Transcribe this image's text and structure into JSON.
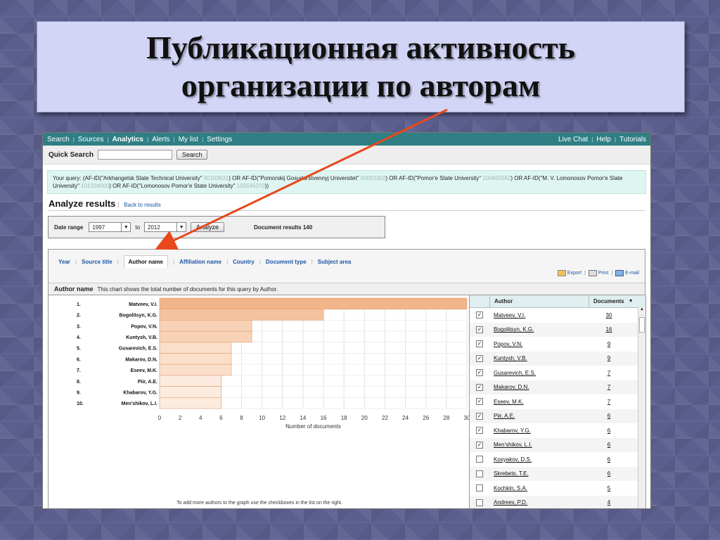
{
  "slide": {
    "title_line1": "Публикационная активность",
    "title_line2": "организации по авторам"
  },
  "nav": {
    "left": [
      "Search",
      "Sources",
      "Analytics",
      "Alerts",
      "My list",
      "Settings"
    ],
    "active": "Analytics",
    "right": [
      "Live Chat",
      "Help",
      "Tutorials"
    ]
  },
  "quick_search": {
    "label": "Quick Search",
    "button": "Search",
    "value": ""
  },
  "query": {
    "prefix": "Your query:",
    "part1": "(AF-ID(\"Arkhangelsk State Technical University\"",
    "id1": "60103631",
    "part2": ") OR AF-ID(\"Pomorskij Gosudarstvennyj Universitet\"",
    "id2": "60002302",
    "part3": ") OR AF-ID(\"Pomor'e State University\"",
    "id3": "100465562",
    "part4": ") OR AF-ID(\"M. V. Lomonosov Pomor'e State University\"",
    "id4": "101334000",
    "part5": ") OR AF-ID(\"Lomonosov Pomor'e State University\"",
    "id5": "105546370",
    "part6": "))"
  },
  "analyze": {
    "heading": "Analyze results",
    "back_link": "Back to results",
    "date_range_label": "Date range",
    "from": "1997",
    "to_label": "to",
    "to": "2012",
    "analyze_button": "Analyze",
    "document_results": "Document results 140"
  },
  "tabs": [
    "Year",
    "Source title",
    "Author name",
    "Affiliation name",
    "Country",
    "Document type",
    "Subject area"
  ],
  "active_tab": "Author name",
  "actions": {
    "export": "Export",
    "print": "Print",
    "email": "E-mail"
  },
  "author_header": {
    "label": "Author name",
    "description": "This chart shows the total number of documents for this query by Author."
  },
  "chart_hint": "To add more authors to the graph use the checkboxes in the list on the right.",
  "chart_data": {
    "type": "bar",
    "orientation": "horizontal",
    "categories": [
      "1.",
      "2.",
      "3.",
      "4.",
      "5.",
      "6.",
      "7.",
      "8.",
      "9.",
      "10."
    ],
    "labels": [
      "Matveev, V.I.",
      "Bogolitsyn, K.G.",
      "Popov, V.N.",
      "Kuntysh, V.B.",
      "Gusarevich, E.S.",
      "Makarov, D.N.",
      "Eseev, M.K.",
      "Piir, A.E.",
      "Khabarov, Y.G.",
      "Men'shikov, L.I."
    ],
    "values": [
      30,
      16,
      9,
      9,
      7,
      7,
      7,
      6,
      6,
      6
    ],
    "xlabel": "Number of documents",
    "xlim": [
      0,
      30
    ],
    "xticks": [
      0,
      2,
      4,
      6,
      8,
      10,
      12,
      14,
      16,
      18,
      20,
      22,
      24,
      26,
      28,
      30
    ],
    "bar_color": "#f2b98e",
    "grid": true
  },
  "table": {
    "col_author": "Author",
    "col_docs": "Documents",
    "rows": [
      {
        "checked": true,
        "author": "Matveev, V.I.",
        "docs": "30"
      },
      {
        "checked": true,
        "author": "Bogolitsyn, K.G.",
        "docs": "16"
      },
      {
        "checked": true,
        "author": "Popov, V.N.",
        "docs": "9"
      },
      {
        "checked": true,
        "author": "Kuntysh, V.B.",
        "docs": "9"
      },
      {
        "checked": true,
        "author": "Gusarevich, E.S.",
        "docs": "7"
      },
      {
        "checked": true,
        "author": "Makarov, D.N.",
        "docs": "7"
      },
      {
        "checked": true,
        "author": "Eseev, M.K.",
        "docs": "7"
      },
      {
        "checked": true,
        "author": "Piir, A.E.",
        "docs": "6"
      },
      {
        "checked": true,
        "author": "Khabarov, Y.G.",
        "docs": "6"
      },
      {
        "checked": true,
        "author": "Men'shikov, L.I.",
        "docs": "6"
      },
      {
        "checked": false,
        "author": "Kosyakov, D.S.",
        "docs": "6"
      },
      {
        "checked": false,
        "author": "Skrebets, T.E.",
        "docs": "6"
      },
      {
        "checked": false,
        "author": "Kochkin, S.A.",
        "docs": "5"
      },
      {
        "checked": false,
        "author": "Andreev, P.D.",
        "docs": "4"
      }
    ]
  },
  "colors": {
    "nav": "#2f7f85",
    "arrow": "#e8481c",
    "title_bg": "#d3d5f6"
  }
}
